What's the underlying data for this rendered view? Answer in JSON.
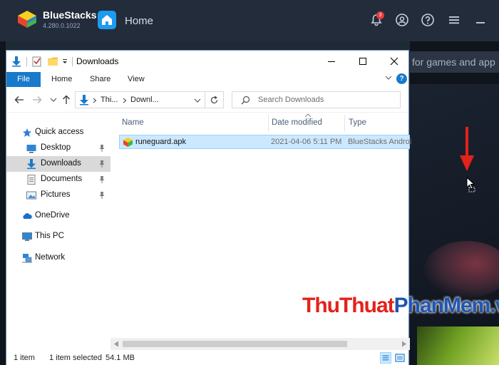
{
  "bluestacks": {
    "app_name": "BlueStacks",
    "version": "4.280.0.1022",
    "home_label": "Home",
    "notification_count": "3",
    "search_placeholder": "for games and app"
  },
  "explorer": {
    "title": "Downloads",
    "ribbon": {
      "file": "File",
      "home": "Home",
      "share": "Share",
      "view": "View"
    },
    "address": {
      "seg1": "Thi...",
      "seg2": "Downl..."
    },
    "search_placeholder": "Search Downloads",
    "nav": [
      {
        "label": "Quick access"
      },
      {
        "label": "Desktop"
      },
      {
        "label": "Downloads"
      },
      {
        "label": "Documents"
      },
      {
        "label": "Pictures"
      },
      {
        "label": "OneDrive"
      },
      {
        "label": "This PC"
      },
      {
        "label": "Network"
      }
    ],
    "columns": {
      "name": "Name",
      "date": "Date modified",
      "type": "Type"
    },
    "files": [
      {
        "name": "runeguard.apk",
        "date": "2021-04-06 5:11 PM",
        "type": "BlueStacks Androi"
      }
    ],
    "status": {
      "count": "1 item",
      "selected": "1 item selected",
      "size": "54.1 MB"
    }
  },
  "watermark": {
    "part1": "ThuThuat",
    "part2": "PhanMem",
    "part3": ".vn"
  },
  "colors": {
    "accent": "#1979ca",
    "selection": "#cce8ff",
    "arrow_red": "#e3221b"
  }
}
